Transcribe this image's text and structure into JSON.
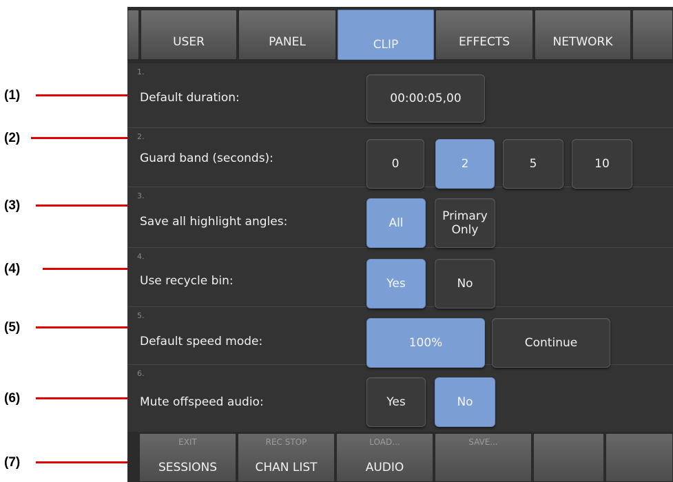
{
  "callouts": [
    "(1)",
    "(2)",
    "(3)",
    "(4)",
    "(5)",
    "(6)",
    "(7)"
  ],
  "tabs": [
    "USER",
    "PANEL",
    "CLIP",
    "EFFECTS",
    "NETWORK"
  ],
  "active_tab": "CLIP",
  "settings": [
    {
      "index": "1.",
      "label": "Default duration:",
      "options": [
        "00:00:05,00"
      ],
      "selected": null
    },
    {
      "index": "2.",
      "label": "Guard band (seconds):",
      "options": [
        "0",
        "2",
        "5",
        "10"
      ],
      "selected": "2"
    },
    {
      "index": "3.",
      "label": "Save all highlight angles:",
      "options": [
        "All",
        "Primary",
        "Only"
      ],
      "selected": "All"
    },
    {
      "index": "4.",
      "label": "Use recycle bin:",
      "options": [
        "Yes",
        "No"
      ],
      "selected": "Yes"
    },
    {
      "index": "5.",
      "label": "Default speed mode:",
      "options": [
        "100%",
        "Continue"
      ],
      "selected": "100%"
    },
    {
      "index": "6.",
      "label": "Mute offspeed audio:",
      "options": [
        "Yes",
        "No"
      ],
      "selected": "No"
    }
  ],
  "bottom_bar": [
    {
      "sub": "EXIT",
      "main": "SESSIONS"
    },
    {
      "sub": "REC STOP",
      "main": "CHAN LIST"
    },
    {
      "sub": "LOAD...",
      "main": "AUDIO"
    },
    {
      "sub": "SAVE...",
      "main": ""
    },
    {
      "sub": "",
      "main": ""
    },
    {
      "sub": "",
      "main": ""
    }
  ],
  "colors": {
    "panel_bg": "#333333",
    "active_blue": "#7b9ed4",
    "callout_red": "#e00000"
  }
}
